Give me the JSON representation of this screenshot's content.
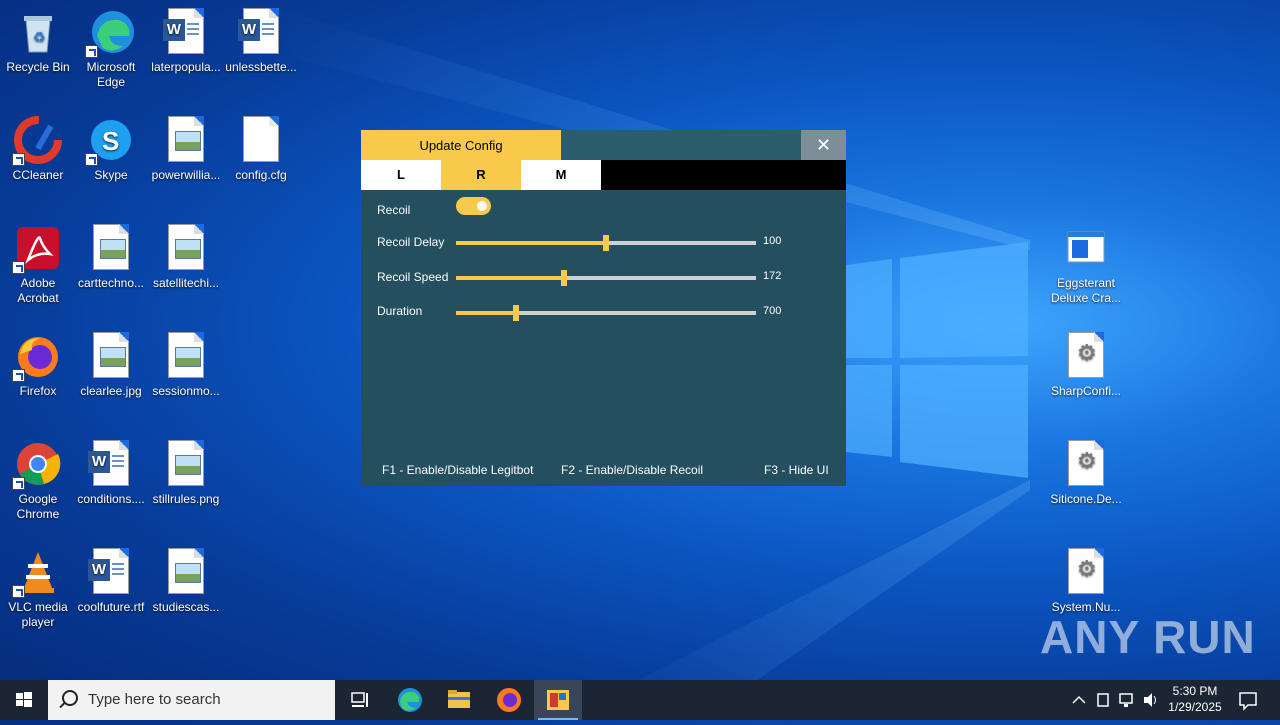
{
  "desktop": {
    "icons_left": [
      {
        "label": "Recycle Bin"
      },
      {
        "label": "Microsoft Edge"
      },
      {
        "label": "laterpopula..."
      },
      {
        "label": "unlessbette..."
      },
      {
        "label": "CCleaner"
      },
      {
        "label": "Skype"
      },
      {
        "label": "powerwillia..."
      },
      {
        "label": "config.cfg"
      },
      {
        "label": "Adobe Acrobat"
      },
      {
        "label": "carttechno..."
      },
      {
        "label": "satellitechi..."
      },
      {
        "label": "Firefox"
      },
      {
        "label": "clearlee.jpg"
      },
      {
        "label": "sessionmo..."
      },
      {
        "label": "Google Chrome"
      },
      {
        "label": "conditions...."
      },
      {
        "label": "stillrules.png"
      },
      {
        "label": "VLC media player"
      },
      {
        "label": "coolfuture.rtf"
      },
      {
        "label": "studiescas..."
      }
    ],
    "icons_right": [
      {
        "label": "Eggsterant Deluxe Cra..."
      },
      {
        "label": "SharpConfi..."
      },
      {
        "label": "Siticone.De..."
      },
      {
        "label": "System.Nu..."
      }
    ]
  },
  "app": {
    "title_tab": "Update Config",
    "close_glyph": "✕",
    "tabs": [
      {
        "label": "L"
      },
      {
        "label": "R"
      },
      {
        "label": "M"
      }
    ],
    "active_tab": "R",
    "recoil_label": "Recoil",
    "recoil_enabled": true,
    "sliders": [
      {
        "label": "Recoil Delay",
        "value": "100",
        "fraction": 0.5
      },
      {
        "label": "Recoil Speed",
        "value": "172",
        "fraction": 0.36
      },
      {
        "label": "Duration",
        "value": "700",
        "fraction": 0.2
      }
    ],
    "footer": {
      "f1": "F1 - Enable/Disable Legitbot",
      "f2": "F2 - Enable/Disable Recoil",
      "f3": "F3 - Hide UI"
    },
    "colors": {
      "accent": "#f8c94a",
      "panel": "#234f5f"
    }
  },
  "taskbar": {
    "search_placeholder": "Type here to search",
    "clock_time": "5:30 PM",
    "clock_date": "1/29/2025"
  },
  "watermark": "ANY RUN"
}
